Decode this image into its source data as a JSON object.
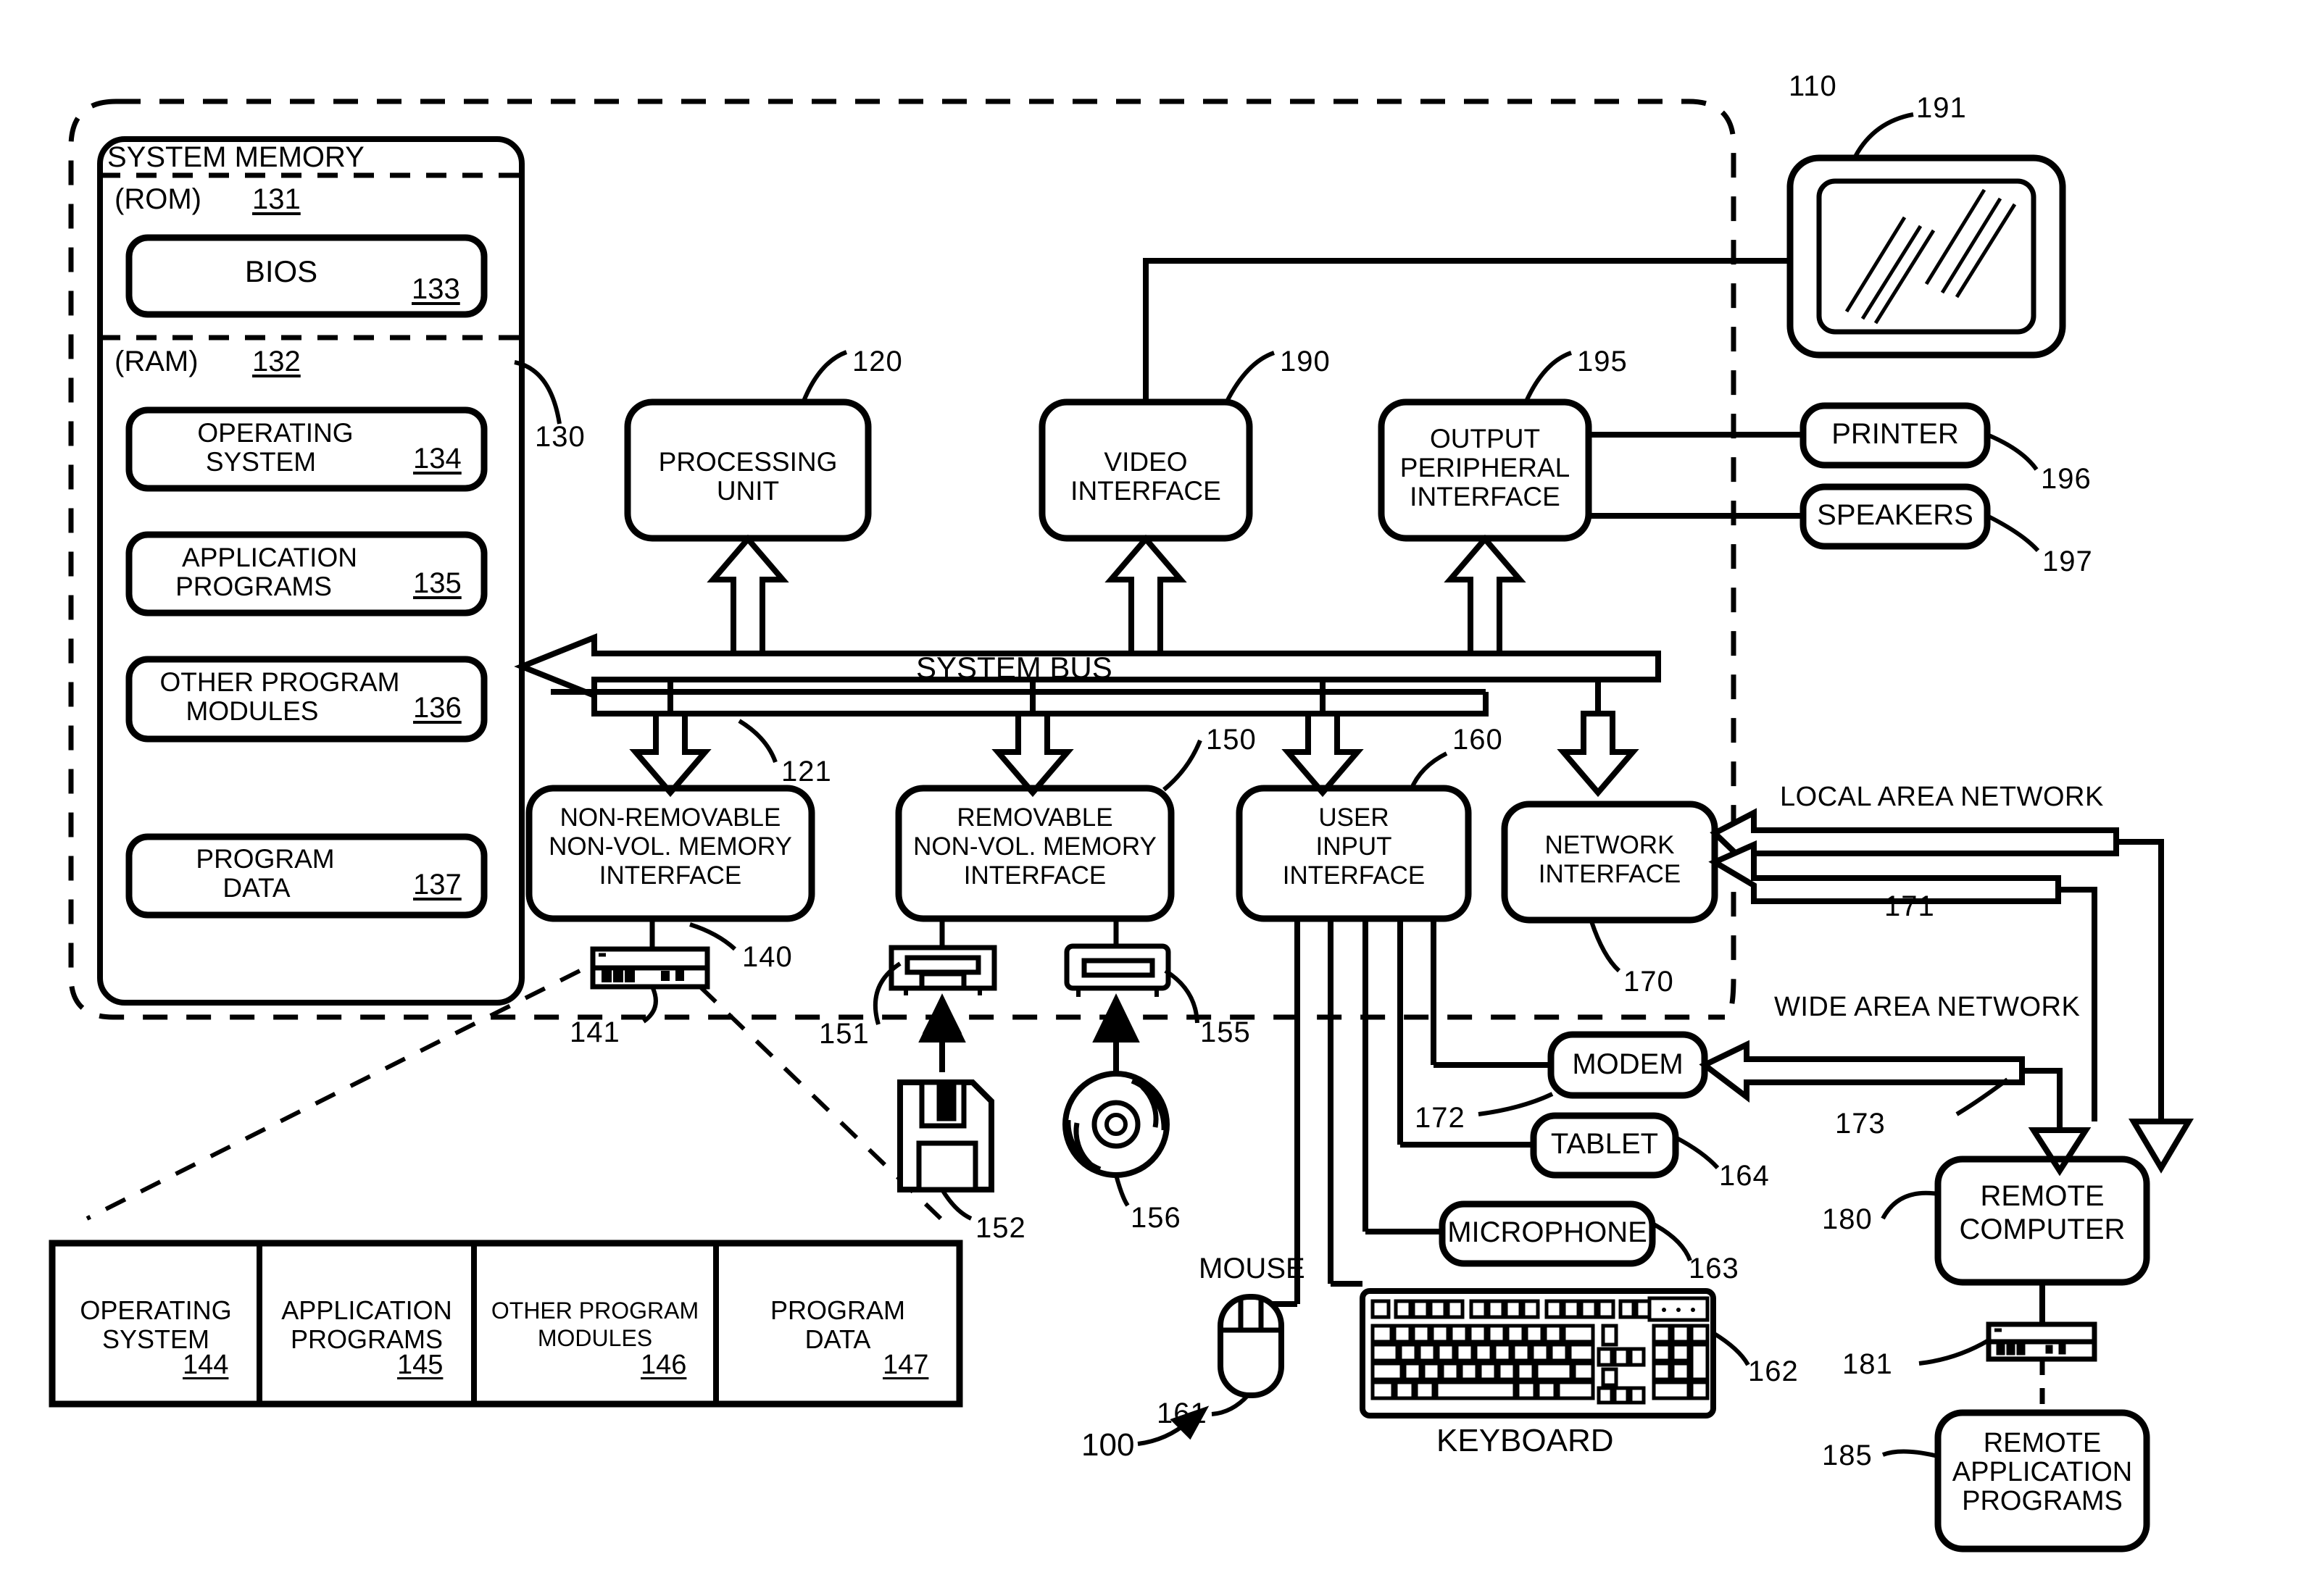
{
  "figure": {
    "name": "computing-environment-block-diagram",
    "overall_ref": "100",
    "computer_ref": "110",
    "stroke_color": "#000000",
    "background": "#ffffff"
  },
  "system_memory": {
    "title": "SYSTEM MEMORY",
    "ref": "130",
    "rom": {
      "label": "(ROM)",
      "ref": "131"
    },
    "bios": {
      "label": "BIOS",
      "ref": "133"
    },
    "ram": {
      "label": "(RAM)",
      "ref": "132"
    },
    "blocks": [
      {
        "line1": "OPERATING",
        "line2": "SYSTEM",
        "ref": "134"
      },
      {
        "line1": "APPLICATION",
        "line2": "PROGRAMS",
        "ref": "135"
      },
      {
        "line1": "OTHER PROGRAM",
        "line2": "MODULES",
        "ref": "136"
      },
      {
        "line1": "PROGRAM",
        "line2": "DATA",
        "ref": "137"
      }
    ]
  },
  "bus": {
    "label": "SYSTEM BUS",
    "ref": "121"
  },
  "top_units": [
    {
      "line1": "PROCESSING",
      "line2": "UNIT",
      "ref": "120"
    },
    {
      "line1": "VIDEO",
      "line2": "INTERFACE",
      "ref": "190"
    },
    {
      "line1": "OUTPUT",
      "line2": "PERIPHERAL",
      "line3": "INTERFACE",
      "ref": "195"
    }
  ],
  "bottom_units": [
    {
      "line1": "NON-REMOVABLE",
      "line2": "NON-VOL. MEMORY",
      "line3": "INTERFACE",
      "ref": "140"
    },
    {
      "line1": "REMOVABLE",
      "line2": "NON-VOL. MEMORY",
      "line3": "INTERFACE",
      "ref": "150"
    },
    {
      "line1": "USER",
      "line2": "INPUT",
      "line3": "INTERFACE",
      "ref": "160"
    },
    {
      "line1": "NETWORK",
      "line2": "INTERFACE",
      "ref": "170"
    }
  ],
  "drives": {
    "hard_disk_ref": "141",
    "floppy_drive_ref": "151",
    "floppy_disk_ref": "152",
    "optical_drive_ref": "155",
    "optical_disc_ref": "156"
  },
  "output_devices": {
    "monitor_ref": "191",
    "printer": {
      "label": "PRINTER",
      "ref": "196"
    },
    "speakers": {
      "label": "SPEAKERS",
      "ref": "197"
    }
  },
  "input_devices": {
    "mouse": {
      "label": "MOUSE",
      "ref": "161"
    },
    "keyboard": {
      "label": "KEYBOARD",
      "ref": "162"
    },
    "microphone": {
      "label": "MICROPHONE",
      "ref": "163"
    },
    "tablet": {
      "label": "TABLET",
      "ref": "164"
    }
  },
  "network": {
    "lan_label": "LOCAL AREA NETWORK",
    "lan_ref": "171",
    "wan_label": "WIDE AREA NETWORK",
    "wan_ref": "173",
    "modem": {
      "label": "MODEM",
      "ref": "172"
    },
    "remote_computer": {
      "line1": "REMOTE",
      "line2": "COMPUTER",
      "ref": "180"
    },
    "remote_memory_ref": "181",
    "remote_apps": {
      "line1": "REMOTE",
      "line2": "APPLICATION",
      "line3": "PROGRAMS",
      "ref": "185"
    }
  },
  "memory_table": {
    "cells": [
      {
        "line1": "OPERATING",
        "line2": "SYSTEM",
        "ref": "144"
      },
      {
        "line1": "APPLICATION",
        "line2": "PROGRAMS",
        "ref": "145"
      },
      {
        "line1": "OTHER PROGRAM",
        "line2": "MODULES",
        "ref": "146"
      },
      {
        "line1": "PROGRAM",
        "line2": "DATA",
        "ref": "147"
      }
    ]
  }
}
